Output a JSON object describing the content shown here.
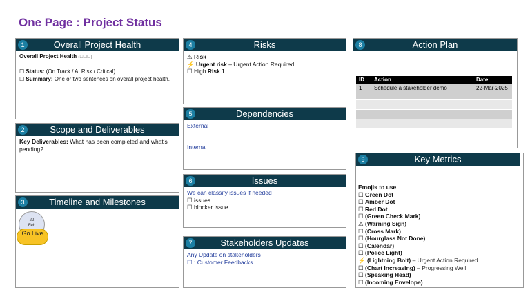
{
  "title": "One Page : Project Status",
  "panels": {
    "health": {
      "num": "1",
      "title": "Overall Project Health",
      "heading": "Overall Project Health",
      "heading_suffix": "(☐☐☐)",
      "status_label": "Status:",
      "status_text": "(On Track / At Risk / Critical)",
      "summary_label": "Summary:",
      "summary_text": "One or two sentences on overall project health."
    },
    "scope": {
      "num": "2",
      "title": "Scope and Deliverables",
      "label": "Key Deliverables:",
      "text": "What has been completed and what's pending?"
    },
    "timeline": {
      "num": "3",
      "title": "Timeline and Milestones",
      "date_day": "22",
      "date_month": "Feb",
      "milestone": "Go Live"
    },
    "risks": {
      "num": "4",
      "title": "Risks",
      "l1": "Risk",
      "l2_bold": "Urgent risk",
      "l2_rest": "– Urgent Action Required",
      "l3_pre": "High",
      "l3_bold": "Risk  1"
    },
    "deps": {
      "num": "5",
      "title": "Dependencies",
      "external": "External",
      "internal": "Internal"
    },
    "issues": {
      "num": "6",
      "title": "Issues",
      "l1": "We can classify issues if needed",
      "l2": "issues",
      "l3": "blocker issue"
    },
    "stake": {
      "num": "7",
      "title": "Stakeholders Updates",
      "l1": "Any Update on stakeholders",
      "l2": ": Customer Feedbacks"
    },
    "action": {
      "num": "8",
      "title": "Action Plan",
      "headers": [
        "ID",
        "Action",
        "Date"
      ],
      "rows": [
        [
          "1",
          "Schedule a stakeholder demo",
          "22-Mar-2025"
        ],
        [
          "",
          "",
          ""
        ],
        [
          "",
          "",
          ""
        ],
        [
          "",
          "",
          ""
        ]
      ]
    },
    "metrics": {
      "num": "9",
      "title": "Key Metrics",
      "heading": "Emojis to use",
      "items": [
        {
          "icon": "☐",
          "bold": "Green Dot",
          "rest": ""
        },
        {
          "icon": "☐",
          "bold": "Amber Dot",
          "rest": ""
        },
        {
          "icon": "☐",
          "bold": "Red Dot",
          "rest": ""
        },
        {
          "icon": "☐",
          "bold": "(Green Check Mark)",
          "rest": ""
        },
        {
          "icon": "⚠",
          "bold": "(Warning Sign)",
          "rest": ""
        },
        {
          "icon": "☐",
          "bold": "(Cross Mark)",
          "rest": ""
        },
        {
          "icon": "☐",
          "bold": "(Hourglass Not Done)",
          "rest": ""
        },
        {
          "icon": "☐",
          "bold": "(Calendar)",
          "rest": ""
        },
        {
          "icon": "☐",
          "bold": "(Police Light)",
          "rest": ""
        },
        {
          "icon": "⚡",
          "bold": "(Lightning Bolt)",
          "rest": " – Urgent Action Required"
        },
        {
          "icon": "☐",
          "bold": "(Chart Increasing)",
          "rest": " – Progressing Well"
        },
        {
          "icon": "☐",
          "bold": "(Speaking Head)",
          "rest": ""
        },
        {
          "icon": "☐",
          "bold": "(Incoming Envelope)",
          "rest": ""
        }
      ]
    }
  }
}
